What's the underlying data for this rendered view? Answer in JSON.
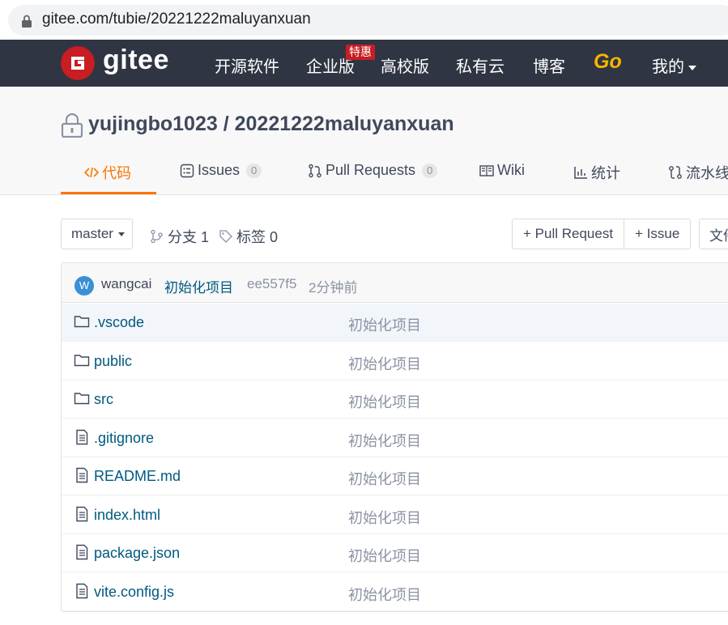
{
  "browser": {
    "url": "gitee.com/tubie/20221222maluyanxuan",
    "lock_icon": "lock-icon"
  },
  "topnav": {
    "logo_text": "gitee",
    "items": [
      "开源软件",
      "企业版",
      "高校版",
      "私有云",
      "博客"
    ],
    "badge": "特惠",
    "go": "Go",
    "mine": "我的"
  },
  "repo": {
    "owner": "yujingbo1023",
    "separator": " / ",
    "name": "20221222maluyanxuan",
    "tabs": [
      {
        "label": "代码",
        "count": ""
      },
      {
        "label": "Issues",
        "count": "0"
      },
      {
        "label": "Pull Requests",
        "count": "0"
      },
      {
        "label": "Wiki",
        "count": ""
      },
      {
        "label": "统计",
        "count": ""
      },
      {
        "label": "流水线",
        "count": ""
      }
    ]
  },
  "toolbar": {
    "branch": "master",
    "branches": "分支 1",
    "tags": "标签 0",
    "pull_request_btn": "+ Pull Request",
    "issue_btn": "+ Issue",
    "file_btn": "文件"
  },
  "commit": {
    "avatar_letter": "W",
    "author": "wangcai",
    "message": "初始化项目",
    "hash": "ee557f5",
    "time": "2分钟前"
  },
  "files": [
    {
      "name": ".vscode",
      "type": "folder",
      "message": "初始化项目"
    },
    {
      "name": "public",
      "type": "folder",
      "message": "初始化项目"
    },
    {
      "name": "src",
      "type": "folder",
      "message": "初始化项目"
    },
    {
      "name": ".gitignore",
      "type": "file",
      "message": "初始化项目"
    },
    {
      "name": "README.md",
      "type": "file",
      "message": "初始化项目"
    },
    {
      "name": "index.html",
      "type": "file",
      "message": "初始化项目"
    },
    {
      "name": "package.json",
      "type": "file",
      "message": "初始化项目"
    },
    {
      "name": "vite.config.js",
      "type": "file",
      "message": "初始化项目"
    }
  ],
  "colors": {
    "nav_bg": "#2f3542",
    "brand_red": "#c71d23",
    "accent_orange": "#fe7300",
    "link_blue": "#005980"
  }
}
